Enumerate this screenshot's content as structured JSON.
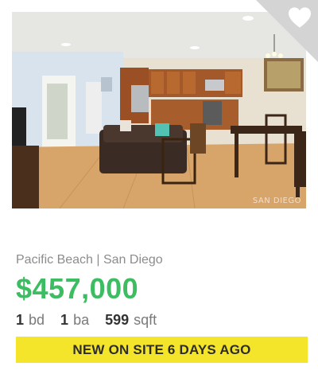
{
  "listing": {
    "location": "Pacific Beach | San Diego",
    "price": "$457,000",
    "beds": {
      "value": "1",
      "unit": "bd"
    },
    "baths": {
      "value": "1",
      "unit": "ba"
    },
    "sqft": {
      "value": "599",
      "unit": "sqft"
    },
    "badge": "NEW ON SITE 6 DAYS AGO",
    "photo_watermark": "SAN DIEGO"
  },
  "icons": {
    "favorite": "heart-icon"
  },
  "colors": {
    "price": "#3dbd61",
    "badge_bg": "#f5e52a",
    "corner": "#d4d4d4"
  }
}
